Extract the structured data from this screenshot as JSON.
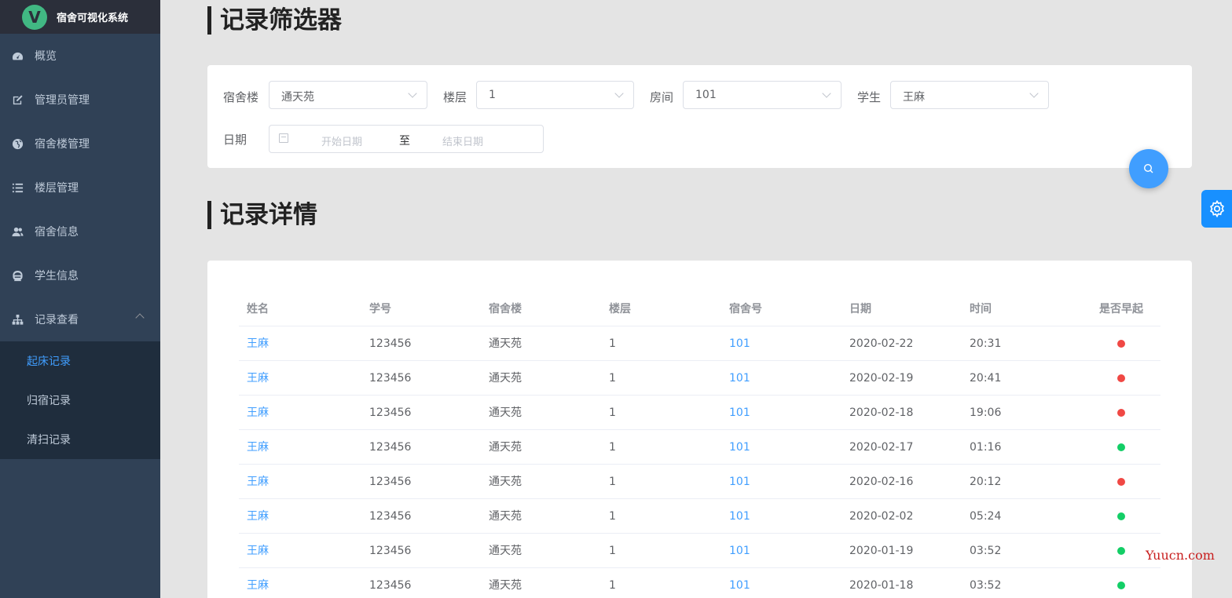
{
  "app": {
    "title": "宿舍可视化系统",
    "logo_letter": "V"
  },
  "sidebar": {
    "items": [
      {
        "label": "概览",
        "icon": "dashboard-icon"
      },
      {
        "label": "管理员管理",
        "icon": "edit-icon"
      },
      {
        "label": "宿舍楼管理",
        "icon": "globe-icon"
      },
      {
        "label": "楼层管理",
        "icon": "list-icon"
      },
      {
        "label": "宿舍信息",
        "icon": "users-icon"
      },
      {
        "label": "学生信息",
        "icon": "student-icon"
      },
      {
        "label": "记录查看",
        "icon": "sitemap-icon",
        "expanded": true
      }
    ],
    "subitems": [
      {
        "label": "起床记录",
        "active": true
      },
      {
        "label": "归宿记录",
        "active": false
      },
      {
        "label": "清扫记录",
        "active": false
      }
    ]
  },
  "filter": {
    "title": "记录筛选器",
    "building_label": "宿舍楼",
    "building_value": "通天苑",
    "floor_label": "楼层",
    "floor_value": "1",
    "room_label": "房间",
    "room_value": "101",
    "student_label": "学生",
    "student_value": "王麻",
    "date_label": "日期",
    "start_placeholder": "开始日期",
    "range_separator": "至",
    "end_placeholder": "结束日期"
  },
  "details": {
    "title": "记录详情",
    "columns": [
      "姓名",
      "学号",
      "宿舍楼",
      "楼层",
      "宿舍号",
      "日期",
      "时间",
      "是否早起"
    ],
    "rows": [
      {
        "name": "王麻",
        "id": "123456",
        "building": "通天苑",
        "floor": "1",
        "room": "101",
        "date": "2020-02-22",
        "time": "20:31",
        "early": false
      },
      {
        "name": "王麻",
        "id": "123456",
        "building": "通天苑",
        "floor": "1",
        "room": "101",
        "date": "2020-02-19",
        "time": "20:41",
        "early": false
      },
      {
        "name": "王麻",
        "id": "123456",
        "building": "通天苑",
        "floor": "1",
        "room": "101",
        "date": "2020-02-18",
        "time": "19:06",
        "early": false
      },
      {
        "name": "王麻",
        "id": "123456",
        "building": "通天苑",
        "floor": "1",
        "room": "101",
        "date": "2020-02-17",
        "time": "01:16",
        "early": true
      },
      {
        "name": "王麻",
        "id": "123456",
        "building": "通天苑",
        "floor": "1",
        "room": "101",
        "date": "2020-02-16",
        "time": "20:12",
        "early": false
      },
      {
        "name": "王麻",
        "id": "123456",
        "building": "通天苑",
        "floor": "1",
        "room": "101",
        "date": "2020-02-02",
        "time": "05:24",
        "early": true
      },
      {
        "name": "王麻",
        "id": "123456",
        "building": "通天苑",
        "floor": "1",
        "room": "101",
        "date": "2020-01-19",
        "time": "03:52",
        "early": true
      },
      {
        "name": "王麻",
        "id": "123456",
        "building": "通天苑",
        "floor": "1",
        "room": "101",
        "date": "2020-01-18",
        "time": "03:52",
        "early": true
      }
    ]
  },
  "colors": {
    "early_yes": "#13ce66",
    "early_no": "#f04844",
    "accent": "#409eff"
  },
  "watermark": "Yuucn.com"
}
